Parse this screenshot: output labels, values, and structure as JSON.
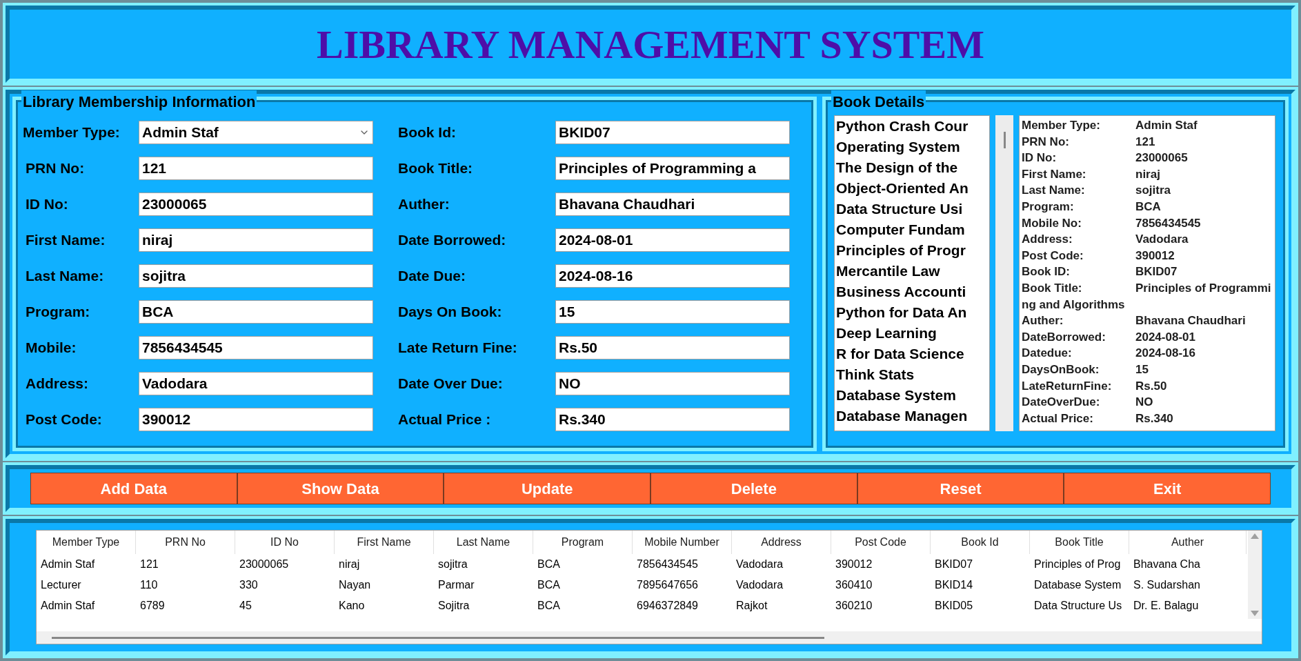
{
  "title": "LIBRARY MANAGEMENT SYSTEM",
  "membership": {
    "title": "Library Membership Information",
    "left_fields": [
      {
        "kind": "dropdown",
        "label": "Member Type:",
        "value": "Admin Staf"
      },
      {
        "kind": "text",
        "label": "PRN No:",
        "value": "121"
      },
      {
        "kind": "text",
        "label": "ID No:",
        "value": "23000065"
      },
      {
        "kind": "text",
        "label": "First Name:",
        "value": "niraj"
      },
      {
        "kind": "text",
        "label": "Last Name:",
        "value": "sojitra"
      },
      {
        "kind": "text",
        "label": "Program:",
        "value": "BCA"
      },
      {
        "kind": "text",
        "label": "Mobile:",
        "value": "7856434545"
      },
      {
        "kind": "text",
        "label": "Address:",
        "value": "Vadodara"
      },
      {
        "kind": "text",
        "label": "Post Code:",
        "value": "390012"
      }
    ],
    "right_fields": [
      {
        "kind": "text",
        "label": "Book Id:",
        "value": "BKID07"
      },
      {
        "kind": "text",
        "label": "Book Title:",
        "value": "Principles of Programming a"
      },
      {
        "kind": "text",
        "label": "Auther:",
        "value": "Bhavana Chaudhari"
      },
      {
        "kind": "text",
        "label": "Date Borrowed:",
        "value": "2024-08-01"
      },
      {
        "kind": "text",
        "label": "Date Due:",
        "value": "2024-08-16"
      },
      {
        "kind": "text",
        "label": "Days On Book:",
        "value": "15"
      },
      {
        "kind": "text",
        "label": "Late Return Fine:",
        "value": "Rs.50"
      },
      {
        "kind": "text",
        "label": "Date Over Due:",
        "value": "NO"
      },
      {
        "kind": "text",
        "label": "Actual Price :",
        "value": "Rs.340"
      }
    ]
  },
  "book_details": {
    "title": "Book Details",
    "books": [
      "Python Crash Cour",
      "Operating System",
      "The Design of the",
      "Object-Oriented An",
      "Data Structure Usi",
      "Computer Fundam",
      "Principles of Progr",
      "Mercantile Law",
      "Business Accounti",
      "Python for Data An",
      "Deep Learning",
      "R for Data Science",
      "Think Stats",
      "Database System",
      "Database Managen"
    ],
    "details": [
      {
        "label": "Member Type:",
        "value": "Admin Staf"
      },
      {
        "label": "PRN No:",
        "value": "121"
      },
      {
        "label": "ID No:",
        "value": "23000065"
      },
      {
        "label": "First Name:",
        "value": "niraj"
      },
      {
        "label": "Last Name:",
        "value": "sojitra"
      },
      {
        "label": "Program:",
        "value": "BCA"
      },
      {
        "label": "Mobile No:",
        "value": "7856434545"
      },
      {
        "label": "Address:",
        "value": "Vadodara"
      },
      {
        "label": "Post Code:",
        "value": "390012"
      },
      {
        "label": "Book ID:",
        "value": "BKID07"
      },
      {
        "label": "Book Title:",
        "value": "Principles of Programming and Algorithms"
      },
      {
        "label": "Auther:",
        "value": "Bhavana Chaudhari"
      },
      {
        "label": "DateBorrowed:",
        "value": "2024-08-01"
      },
      {
        "label": "Datedue:",
        "value": "2024-08-16"
      },
      {
        "label": "DaysOnBook:",
        "value": "15"
      },
      {
        "label": "LateReturnFine:",
        "value": "Rs.50"
      },
      {
        "label": "DateOverDue:",
        "value": "NO"
      },
      {
        "label": "Actual Price:",
        "value": "Rs.340"
      }
    ]
  },
  "buttons": [
    "Add Data",
    "Show Data",
    "Update",
    "Delete",
    "Reset",
    "Exit"
  ],
  "table": {
    "columns": [
      "Member Type",
      "PRN No",
      "ID No",
      "First Name",
      "Last Name",
      "Program",
      "Mobile Number",
      "Address",
      "Post Code",
      "Book Id",
      "Book Title",
      "Auther"
    ],
    "rows": [
      [
        "Admin Staf",
        "121",
        "23000065",
        "niraj",
        "sojitra",
        "BCA",
        "7856434545",
        "Vadodara",
        "390012",
        "BKID07",
        "Principles of Prog",
        "Bhavana Cha"
      ],
      [
        "Lecturer",
        "110",
        "330",
        "Nayan",
        "Parmar",
        "BCA",
        "7895647656",
        "Vadodara",
        "360410",
        "BKID14",
        "Database System",
        "S. Sudarshan"
      ],
      [
        "Admin Staf",
        "6789",
        "45",
        "Kano",
        "Sojitra",
        "BCA",
        "6946372849",
        "Rajkot",
        "360210",
        "BKID05",
        "Data Structure Us",
        "Dr. E. Balagu"
      ]
    ]
  }
}
